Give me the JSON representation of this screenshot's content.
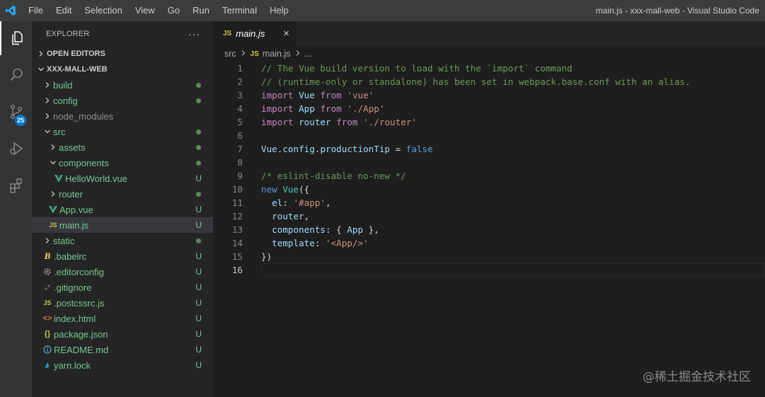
{
  "window": {
    "title": "main.js - xxx-mall-web - Visual Studio Code",
    "menu": [
      "File",
      "Edit",
      "Selection",
      "View",
      "Go",
      "Run",
      "Terminal",
      "Help"
    ]
  },
  "activity_bar": {
    "items": [
      {
        "name": "explorer",
        "icon": "files-icon",
        "active": true
      },
      {
        "name": "search",
        "icon": "search-icon"
      },
      {
        "name": "source-control",
        "icon": "source-control-icon",
        "badge": "25"
      },
      {
        "name": "run-debug",
        "icon": "debug-icon"
      },
      {
        "name": "extensions",
        "icon": "extensions-icon"
      }
    ]
  },
  "explorer": {
    "header": "EXPLORER",
    "more": "···",
    "open_editors": "OPEN EDITORS",
    "project": "XXX-MALL-WEB",
    "tree": [
      {
        "label": "build",
        "indent": 1,
        "type": "folder",
        "expanded": false,
        "status": "dot",
        "color": "#73c991"
      },
      {
        "label": "config",
        "indent": 1,
        "type": "folder",
        "expanded": false,
        "status": "dot",
        "color": "#73c991"
      },
      {
        "label": "node_modules",
        "indent": 1,
        "type": "folder",
        "expanded": false,
        "status": "",
        "color": "#8c8c8c"
      },
      {
        "label": "src",
        "indent": 1,
        "type": "folder",
        "expanded": true,
        "status": "dot",
        "color": "#73c991"
      },
      {
        "label": "assets",
        "indent": 2,
        "type": "folder",
        "expanded": false,
        "status": "dot",
        "color": "#73c991"
      },
      {
        "label": "components",
        "indent": 2,
        "type": "folder",
        "expanded": true,
        "status": "dot",
        "color": "#73c991"
      },
      {
        "label": "HelloWorld.vue",
        "indent": 3,
        "type": "vue",
        "status": "U",
        "color": "#73c991"
      },
      {
        "label": "router",
        "indent": 2,
        "type": "folder",
        "expanded": false,
        "status": "dot",
        "color": "#73c991"
      },
      {
        "label": "App.vue",
        "indent": 2,
        "type": "vue",
        "status": "U",
        "color": "#73c991"
      },
      {
        "label": "main.js",
        "indent": 2,
        "type": "js",
        "status": "U",
        "color": "#73c991",
        "selected": true
      },
      {
        "label": "static",
        "indent": 1,
        "type": "folder",
        "expanded": false,
        "status": "dot",
        "color": "#73c991"
      },
      {
        "label": ".babelrc",
        "indent": 1,
        "type": "babel",
        "status": "U",
        "color": "#73c991"
      },
      {
        "label": ".editorconfig",
        "indent": 1,
        "type": "gear",
        "status": "U",
        "color": "#73c991"
      },
      {
        "label": ".gitignore",
        "indent": 1,
        "type": "git",
        "status": "U",
        "color": "#73c991"
      },
      {
        "label": ".postcssrc.js",
        "indent": 1,
        "type": "js",
        "status": "U",
        "color": "#73c991"
      },
      {
        "label": "index.html",
        "indent": 1,
        "type": "html",
        "status": "U",
        "color": "#73c991"
      },
      {
        "label": "package.json",
        "indent": 1,
        "type": "json",
        "status": "U",
        "color": "#73c991"
      },
      {
        "label": "README.md",
        "indent": 1,
        "type": "md",
        "status": "U",
        "color": "#73c991"
      },
      {
        "label": "yarn.lock",
        "indent": 1,
        "type": "yarn",
        "status": "U",
        "color": "#73c991"
      }
    ]
  },
  "editor": {
    "tab": {
      "icon_text": "JS",
      "label": "main.js",
      "close": "×"
    },
    "breadcrumb": {
      "folder": "src",
      "icon_text": "JS",
      "file": "main.js",
      "more": "..."
    },
    "lines": [
      {
        "n": "1",
        "tokens": [
          [
            "cm",
            "// The Vue build version to load with the `import` command"
          ]
        ]
      },
      {
        "n": "2",
        "tokens": [
          [
            "cm",
            "// (runtime-only or standalone) has been set in webpack.base.conf with an alias."
          ]
        ]
      },
      {
        "n": "3",
        "tokens": [
          [
            "kw2",
            "import"
          ],
          [
            "pl",
            " "
          ],
          [
            "id",
            "Vue"
          ],
          [
            "pl",
            " "
          ],
          [
            "kw2",
            "from"
          ],
          [
            "pl",
            " "
          ],
          [
            "str",
            "'vue'"
          ]
        ]
      },
      {
        "n": "4",
        "tokens": [
          [
            "kw2",
            "import"
          ],
          [
            "pl",
            " "
          ],
          [
            "id",
            "App"
          ],
          [
            "pl",
            " "
          ],
          [
            "kw2",
            "from"
          ],
          [
            "pl",
            " "
          ],
          [
            "str",
            "'./App'"
          ]
        ]
      },
      {
        "n": "5",
        "tokens": [
          [
            "kw2",
            "import"
          ],
          [
            "pl",
            " "
          ],
          [
            "id",
            "router"
          ],
          [
            "pl",
            " "
          ],
          [
            "kw2",
            "from"
          ],
          [
            "pl",
            " "
          ],
          [
            "str",
            "'./router'"
          ]
        ]
      },
      {
        "n": "6",
        "tokens": []
      },
      {
        "n": "7",
        "tokens": [
          [
            "id",
            "Vue"
          ],
          [
            "pl",
            "."
          ],
          [
            "id",
            "config"
          ],
          [
            "pl",
            "."
          ],
          [
            "id",
            "productionTip"
          ],
          [
            "pl",
            " = "
          ],
          [
            "kw",
            "false"
          ]
        ]
      },
      {
        "n": "8",
        "tokens": []
      },
      {
        "n": "9",
        "tokens": [
          [
            "cm",
            "/* eslint-disable no-new */"
          ]
        ]
      },
      {
        "n": "10",
        "tokens": [
          [
            "kw",
            "new"
          ],
          [
            "pl",
            " "
          ],
          [
            "cls",
            "Vue"
          ],
          [
            "pl",
            "({"
          ]
        ]
      },
      {
        "n": "11",
        "tokens": [
          [
            "pl",
            "  "
          ],
          [
            "id",
            "el"
          ],
          [
            "pl",
            ": "
          ],
          [
            "str",
            "'#app'"
          ],
          [
            "pl",
            ","
          ]
        ]
      },
      {
        "n": "12",
        "tokens": [
          [
            "pl",
            "  "
          ],
          [
            "id",
            "router"
          ],
          [
            "pl",
            ","
          ]
        ]
      },
      {
        "n": "13",
        "tokens": [
          [
            "pl",
            "  "
          ],
          [
            "id",
            "components"
          ],
          [
            "pl",
            ": { "
          ],
          [
            "id",
            "App"
          ],
          [
            "pl",
            " },"
          ]
        ]
      },
      {
        "n": "14",
        "tokens": [
          [
            "pl",
            "  "
          ],
          [
            "id",
            "template"
          ],
          [
            "pl",
            ": "
          ],
          [
            "str",
            "'<App/>'"
          ]
        ]
      },
      {
        "n": "15",
        "tokens": [
          [
            "pl",
            "})"
          ]
        ]
      },
      {
        "n": "16",
        "tokens": [],
        "current": true
      }
    ]
  },
  "watermark": "@稀土掘金技术社区"
}
